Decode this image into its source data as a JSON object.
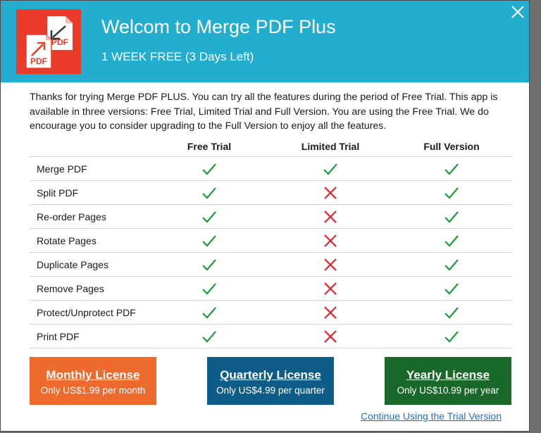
{
  "header": {
    "title": "Welcom to Merge PDF Plus",
    "subtitle": "1 WEEK FREE (3 Days Left)",
    "logo_text_back": "PDF",
    "logo_text_front": "PDF",
    "color": "#23aed0"
  },
  "intro": "Thanks for trying Merge PDF PLUS. You can try all the features during the period of Free Trial. This app is available in three versions: Free Trial, Limited Trial and Full Version. You are using the Free Trial. We do encourage you to consider upgrading to the Full Version to enjoy all the features.",
  "table": {
    "columns": [
      "Free Trial",
      "Limited Trial",
      "Full Version"
    ],
    "rows": [
      {
        "feature": "Merge PDF",
        "values": [
          "check",
          "check",
          "check"
        ]
      },
      {
        "feature": "Split PDF",
        "values": [
          "check",
          "cross",
          "check"
        ]
      },
      {
        "feature": "Re-order Pages",
        "values": [
          "check",
          "cross",
          "check"
        ]
      },
      {
        "feature": "Rotate Pages",
        "values": [
          "check",
          "cross",
          "check"
        ]
      },
      {
        "feature": "Duplicate Pages",
        "values": [
          "check",
          "cross",
          "check"
        ]
      },
      {
        "feature": "Remove Pages",
        "values": [
          "check",
          "cross",
          "check"
        ]
      },
      {
        "feature": "Protect/Unprotect PDF",
        "values": [
          "check",
          "cross",
          "check"
        ]
      },
      {
        "feature": "Print PDF",
        "values": [
          "check",
          "cross",
          "check"
        ]
      }
    ]
  },
  "buttons": {
    "monthly": {
      "title": "Monthly License",
      "sub": "Only US$1.99 per month",
      "color": "#ee6a2c"
    },
    "quarterly": {
      "title": "Quarterly License",
      "sub": "Only US$4.99 per quarter",
      "color": "#0e5d89"
    },
    "yearly": {
      "title": "Yearly License",
      "sub": "Only US$10.99 per year",
      "color": "#19682a"
    }
  },
  "trial_link": "Continue Using the Trial Version",
  "colors": {
    "check": "#1e9a3a",
    "cross": "#e2232a"
  }
}
